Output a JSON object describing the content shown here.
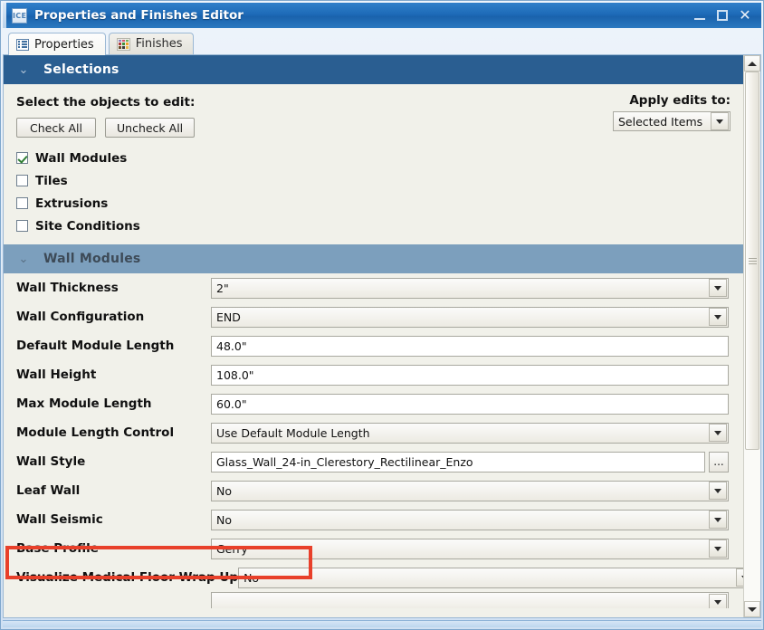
{
  "window": {
    "title": "Properties and Finishes Editor",
    "app_icon_text": "ICE",
    "minimize_label": "_",
    "maximize_label": "",
    "close_label": "✕",
    "accent_color": "#1e6bb8"
  },
  "tabs": [
    {
      "label": "Properties",
      "icon": "list-icon",
      "active": true
    },
    {
      "label": "Finishes",
      "icon": "color-grid-icon",
      "active": false
    }
  ],
  "selections": {
    "header": "Selections",
    "chevron": "⌄",
    "header_color": "#2a5e91",
    "instruction": "Select the objects to edit:",
    "apply_label": "Apply edits to:",
    "apply_value": "Selected Items",
    "buttons": [
      {
        "label": "Check All"
      },
      {
        "label": "Uncheck All"
      }
    ],
    "checkboxes": [
      {
        "label": "Wall Modules",
        "checked": true
      },
      {
        "label": "Tiles",
        "checked": false
      },
      {
        "label": "Extrusions",
        "checked": false
      },
      {
        "label": "Site Conditions",
        "checked": false
      }
    ]
  },
  "wall_modules": {
    "header": "Wall Modules",
    "chevron": "⌄",
    "header_color": "#7c9fbd",
    "rows": [
      {
        "label": "Wall Thickness",
        "value": "2\"",
        "type": "combo"
      },
      {
        "label": "Wall Configuration",
        "value": "END",
        "type": "combo"
      },
      {
        "label": "Default Module Length",
        "value": "48.0\"",
        "type": "text"
      },
      {
        "label": "Wall Height",
        "value": "108.0\"",
        "type": "text"
      },
      {
        "label": "Max Module Length",
        "value": "60.0\"",
        "type": "text"
      },
      {
        "label": "Module Length Control",
        "value": "Use Default Module Length",
        "type": "combo"
      },
      {
        "label": "Wall Style",
        "value": "Glass_Wall_24-in_Clerestory_Rectilinear_Enzo",
        "type": "text-browse",
        "browse_label": "..."
      },
      {
        "label": "Leaf Wall",
        "value": "No",
        "type": "combo"
      },
      {
        "label": "Wall Seismic",
        "value": "No",
        "type": "combo"
      },
      {
        "label": "Base Profile",
        "value": "Gerry",
        "type": "combo",
        "highlighted": true
      },
      {
        "label": "Visualize Medical Floor Wrap Up",
        "value": "No",
        "type": "combo"
      }
    ]
  },
  "highlight": {
    "color": "#e8402a",
    "target_row_label": "Base Profile"
  },
  "scrollbar": {
    "up_arrow": "▲",
    "down_arrow": "▼",
    "thumb_position_percent": 0
  }
}
